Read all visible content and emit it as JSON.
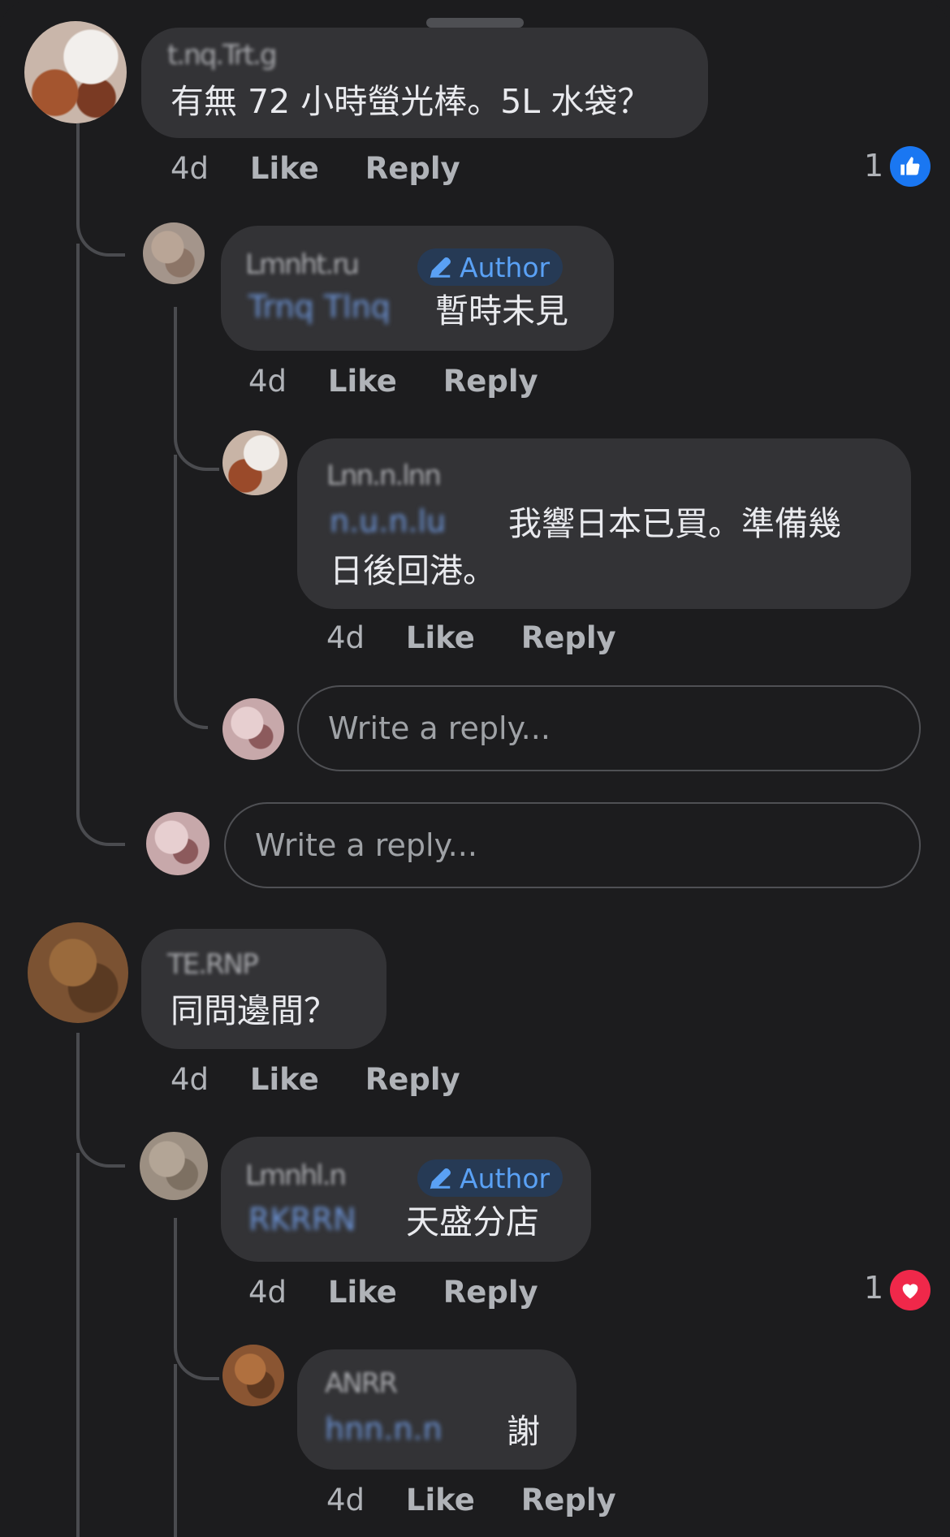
{
  "thread1": {
    "comment": {
      "name_blurred": "t.nq.Trt.g",
      "text": "有無 72 小時螢光棒。5L 水袋？",
      "time": "4d",
      "like": "Like",
      "reply": "Reply",
      "reaction_count": "1",
      "reaction": "like"
    },
    "reply1": {
      "name_blurred": "Lmnht.ru",
      "author_badge": "Author",
      "mention_blurred": "Trnq Tlnq",
      "text": "暫時未見",
      "time": "4d",
      "like": "Like",
      "reply": "Reply"
    },
    "reply2": {
      "name_blurred": "Lnn.n.lnn",
      "mention_blurred": "n.u.n.lu",
      "text_line1": "我響日本已買。準備幾",
      "text_line2": "日後回港。",
      "time": "4d",
      "like": "Like",
      "reply": "Reply"
    },
    "nested_input_placeholder": "Write a reply...",
    "input_placeholder": "Write a reply..."
  },
  "thread2": {
    "comment": {
      "name_blurred": "TE.RNP",
      "text": "同問邊間？",
      "time": "4d",
      "like": "Like",
      "reply": "Reply"
    },
    "reply1": {
      "name_blurred": "Lmnhl.n",
      "author_badge": "Author",
      "mention_blurred": "RKRRN",
      "text": "天盛分店",
      "time": "4d",
      "like": "Like",
      "reply": "Reply",
      "reaction_count": "1",
      "reaction": "love"
    },
    "reply2": {
      "name_blurred": "ANRR",
      "mention_blurred": "hnn.n.n",
      "text": "謝",
      "time": "4d",
      "like": "Like",
      "reply": "Reply"
    }
  },
  "colors": {
    "background": "#1c1c1e",
    "bubble": "#333336",
    "author_badge": "#263a55",
    "author_text": "#5aa1f5",
    "like_blue": "#1a77f2",
    "love_red": "#f0284a"
  }
}
